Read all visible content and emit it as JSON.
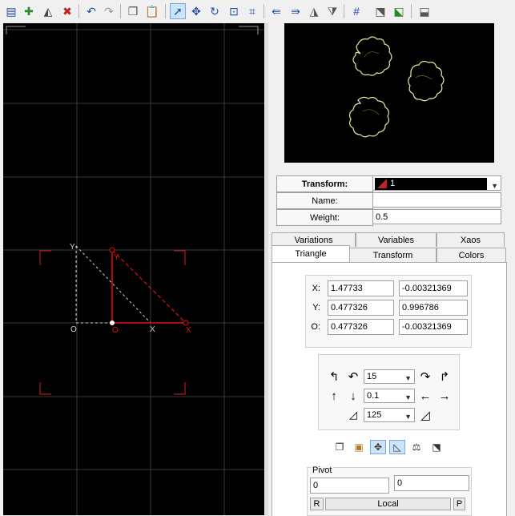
{
  "toolbar": {
    "icons": [
      "new-flame-icon",
      "add-transform-icon",
      "duplicate-transform-icon",
      "delete-transform-icon",
      "undo-icon",
      "redo-icon",
      "copy-icon",
      "paste-icon",
      "select-mode-icon",
      "move-mode-icon",
      "rotate-mode-icon",
      "scale-mode-icon",
      "fit-icon",
      "flip-left-icon",
      "flip-right-icon",
      "flip-horizontal-icon",
      "flip-vertical-icon",
      "grid-icon",
      "post-transform-icon",
      "final-transform-icon",
      "reset-transform-icon"
    ]
  },
  "editor": {
    "labels": {
      "y_ref": "Y",
      "o_ref": "O",
      "x_ref": "X",
      "y_tri": "Y",
      "o_tri": "O",
      "x_tri": "X"
    }
  },
  "transform": {
    "label": "Transform:",
    "selected": "1",
    "name_label": "Name:",
    "name_value": "",
    "weight_label": "Weight:",
    "weight_value": "0.5"
  },
  "tabs": {
    "row1": [
      "Variations",
      "Variables",
      "Xaos"
    ],
    "row2": [
      "Triangle",
      "Transform",
      "Colors"
    ]
  },
  "coords": {
    "x_label": "X:",
    "x1": "1.47733",
    "x2": "-0.00321369",
    "y_label": "Y:",
    "y1": "0.477326",
    "y2": "0.996786",
    "o_label": "O:",
    "o1": "0.477326",
    "o2": "-0.00321369"
  },
  "ops": {
    "angle": "15",
    "step": "0.1",
    "scale": "125"
  },
  "pivot": {
    "label": "Pivot",
    "x": "0",
    "y": "0",
    "r_label": "R",
    "mode": "Local",
    "p_label": "P"
  },
  "colors": {
    "triangle": "#e01010",
    "reference": "#cfcfcf",
    "fractal": "#e8e6a0"
  }
}
